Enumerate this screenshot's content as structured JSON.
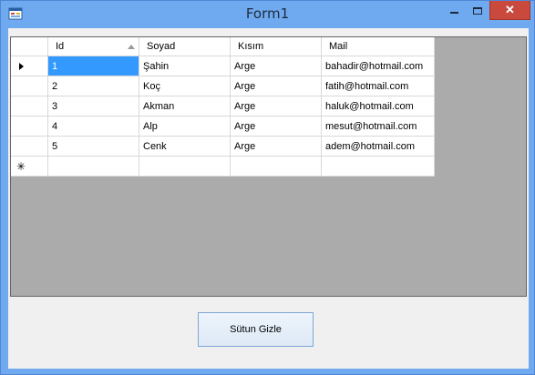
{
  "window": {
    "title": "Form1"
  },
  "grid": {
    "columns": [
      "Id",
      "Soyad",
      "Kısım",
      "Mail"
    ],
    "rows": [
      [
        "1",
        "Şahin",
        "Arge",
        "bahadir@hotmail.com"
      ],
      [
        "2",
        "Koç",
        "Arge",
        "fatih@hotmail.com"
      ],
      [
        "3",
        "Akman",
        "Arge",
        "haluk@hotmail.com"
      ],
      [
        "4",
        "Alp",
        "Arge",
        "mesut@hotmail.com"
      ],
      [
        "5",
        "Cenk",
        "Arge",
        "adem@hotmail.com"
      ]
    ],
    "new_row_marker": "✳",
    "current_row_marker": "▶"
  },
  "button": {
    "label": "Sütun Gizle"
  }
}
